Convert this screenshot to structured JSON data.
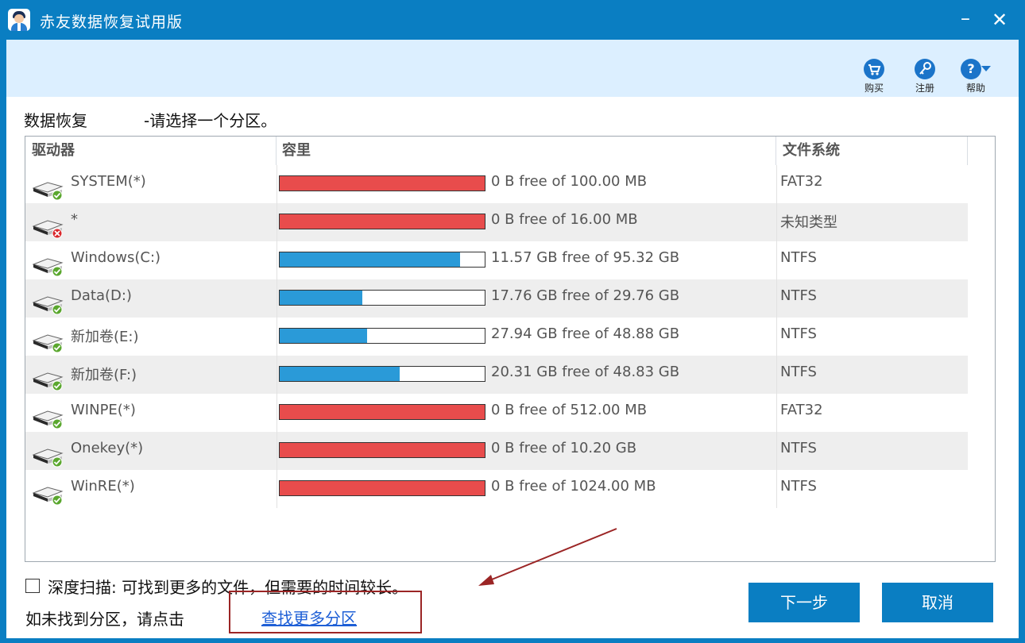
{
  "app": {
    "title": "赤友数据恢复试用版",
    "min_symbol": "–",
    "close_symbol": "✕"
  },
  "toolbar": {
    "buy_label": "购买",
    "register_label": "注册",
    "help_label": "帮助"
  },
  "header": {
    "section": "数据恢复",
    "hint": "-请选择一个分区。"
  },
  "table": {
    "columns": [
      "驱动器",
      "容里",
      "文件系统"
    ],
    "rows": [
      {
        "name": "SYSTEM(*)",
        "capacity": "0 B free of 100.00 MB",
        "fs": "FAT32",
        "used_fraction": 1.0,
        "bar_color": "#e84c4c",
        "status": "ok"
      },
      {
        "name": "*",
        "capacity": "0 B free of 16.00 MB",
        "fs": "未知类型",
        "used_fraction": 1.0,
        "bar_color": "#e84c4c",
        "status": "error"
      },
      {
        "name": "Windows(C:)",
        "capacity": "11.57 GB free of 95.32 GB",
        "fs": "NTFS",
        "used_fraction": 0.879,
        "bar_color": "#2a9ad8",
        "status": "ok"
      },
      {
        "name": "Data(D:)",
        "capacity": "17.76 GB free of 29.76 GB",
        "fs": "NTFS",
        "used_fraction": 0.403,
        "bar_color": "#2a9ad8",
        "status": "ok"
      },
      {
        "name": "新加卷(E:)",
        "capacity": "27.94 GB free of 48.88 GB",
        "fs": "NTFS",
        "used_fraction": 0.428,
        "bar_color": "#2a9ad8",
        "status": "ok"
      },
      {
        "name": "新加卷(F:)",
        "capacity": "20.31 GB free of 48.83 GB",
        "fs": "NTFS",
        "used_fraction": 0.584,
        "bar_color": "#2a9ad8",
        "status": "ok"
      },
      {
        "name": "WINPE(*)",
        "capacity": "0 B free of 512.00 MB",
        "fs": "FAT32",
        "used_fraction": 1.0,
        "bar_color": "#e84c4c",
        "status": "ok"
      },
      {
        "name": "Onekey(*)",
        "capacity": "0 B free of 10.20 GB",
        "fs": "NTFS",
        "used_fraction": 1.0,
        "bar_color": "#e84c4c",
        "status": "ok"
      },
      {
        "name": "WinRE(*)",
        "capacity": "0 B free of 1024.00 MB",
        "fs": "NTFS",
        "used_fraction": 1.0,
        "bar_color": "#e84c4c",
        "status": "ok"
      }
    ]
  },
  "footer": {
    "deep_scan_label": "深度扫描: 可找到更多的文件，但需要的时间较长。",
    "deep_scan_checked": false,
    "not_found_text": "如未找到分区，请点击",
    "more_link": "查找更多分区",
    "next_label": "下一步",
    "cancel_label": "取消"
  },
  "icons": {
    "buy": "cart-icon",
    "register": "key-icon",
    "help": "question-icon",
    "drive": "drive-icon",
    "ok_badge": "check-badge-icon",
    "error_badge": "x-badge-icon"
  }
}
